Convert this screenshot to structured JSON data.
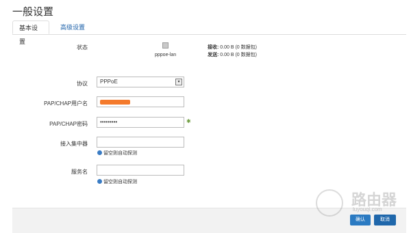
{
  "page": {
    "title": "一般设置"
  },
  "tabs": [
    {
      "label": "基本设置",
      "active": true
    },
    {
      "label": "高级设置",
      "active": false
    }
  ],
  "status": {
    "label": "状态",
    "interface_icon": "network-port-icon",
    "interface": "pppoe-lan",
    "rx_label": "接收:",
    "rx_value": "0.00 B (0 数据包)",
    "tx_label": "发送:",
    "tx_value": "0.00 B (0 数据包)"
  },
  "form": {
    "protocol": {
      "label": "协议",
      "value": "PPPoE"
    },
    "username": {
      "label": "PAP/CHAP用户名",
      "value": ""
    },
    "password": {
      "label": "PAP/CHAP密码",
      "value": "•••••••••"
    },
    "concentrator": {
      "label": "接入集中器",
      "hint": "留空则自动探测"
    },
    "service": {
      "label": "服务名",
      "hint": "留空则自动探测"
    }
  },
  "footer": {
    "ok_label": "确认",
    "cancel_label": "取消"
  },
  "watermark": {
    "text": "路由器",
    "url": "luyouqi.com"
  },
  "colors": {
    "accent": "#2a7ac2",
    "masked": "#f47a2c",
    "link": "#1a5fa8"
  }
}
